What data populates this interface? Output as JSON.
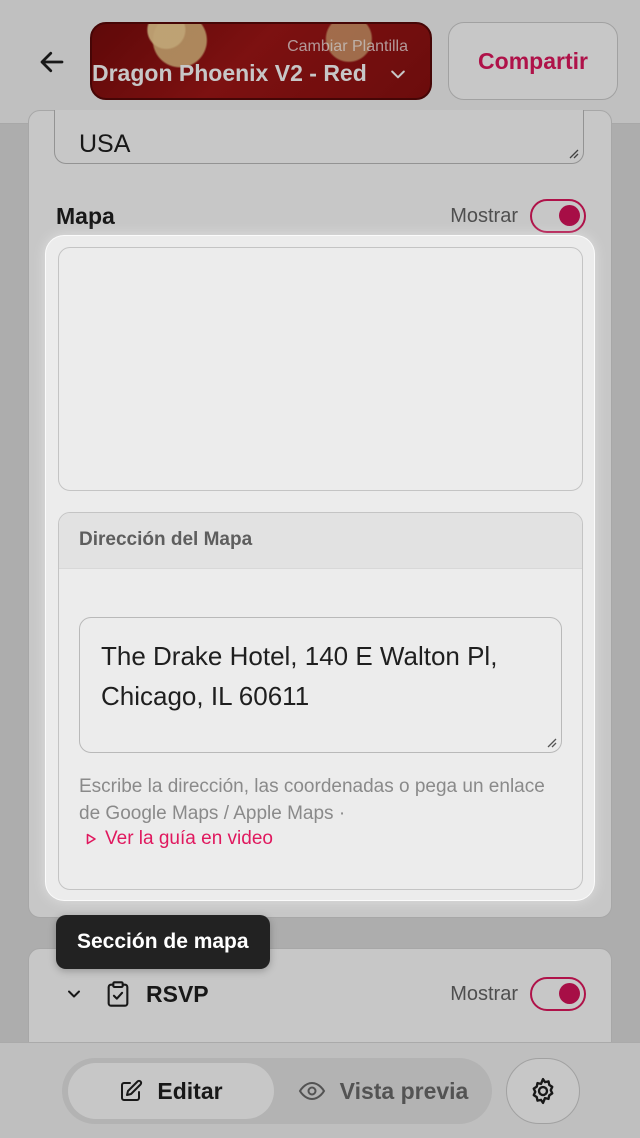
{
  "header": {
    "back_icon": "arrow-left-icon",
    "template_caption": "Cambiar Plantilla",
    "template_name": "Dragon Phoenix V2 - Red",
    "share_label": "Compartir"
  },
  "address": {
    "country_value": "USA"
  },
  "map_section": {
    "title": "Mapa",
    "show_label": "Mostrar",
    "toggle_on": true,
    "address_card_title": "Dirección del Mapa",
    "address_value": "The Drake Hotel, 140 E Walton Pl, Chicago, IL 60611",
    "help_text": "Escribe la dirección, las coordenadas o pega un enlace de Google Maps / Apple Maps ·",
    "video_link_label": "Ver la guía en video"
  },
  "tooltip": {
    "text": "Sección de mapa"
  },
  "rsvp_section": {
    "title": "RSVP",
    "show_label": "Mostrar",
    "toggle_on": true,
    "icon": "clipboard-check-icon"
  },
  "bottom_nav": {
    "edit_label": "Editar",
    "preview_label": "Vista previa",
    "settings_icon": "gear-icon"
  },
  "colors": {
    "accent": "#e0185e",
    "template_red": "#a01616"
  }
}
